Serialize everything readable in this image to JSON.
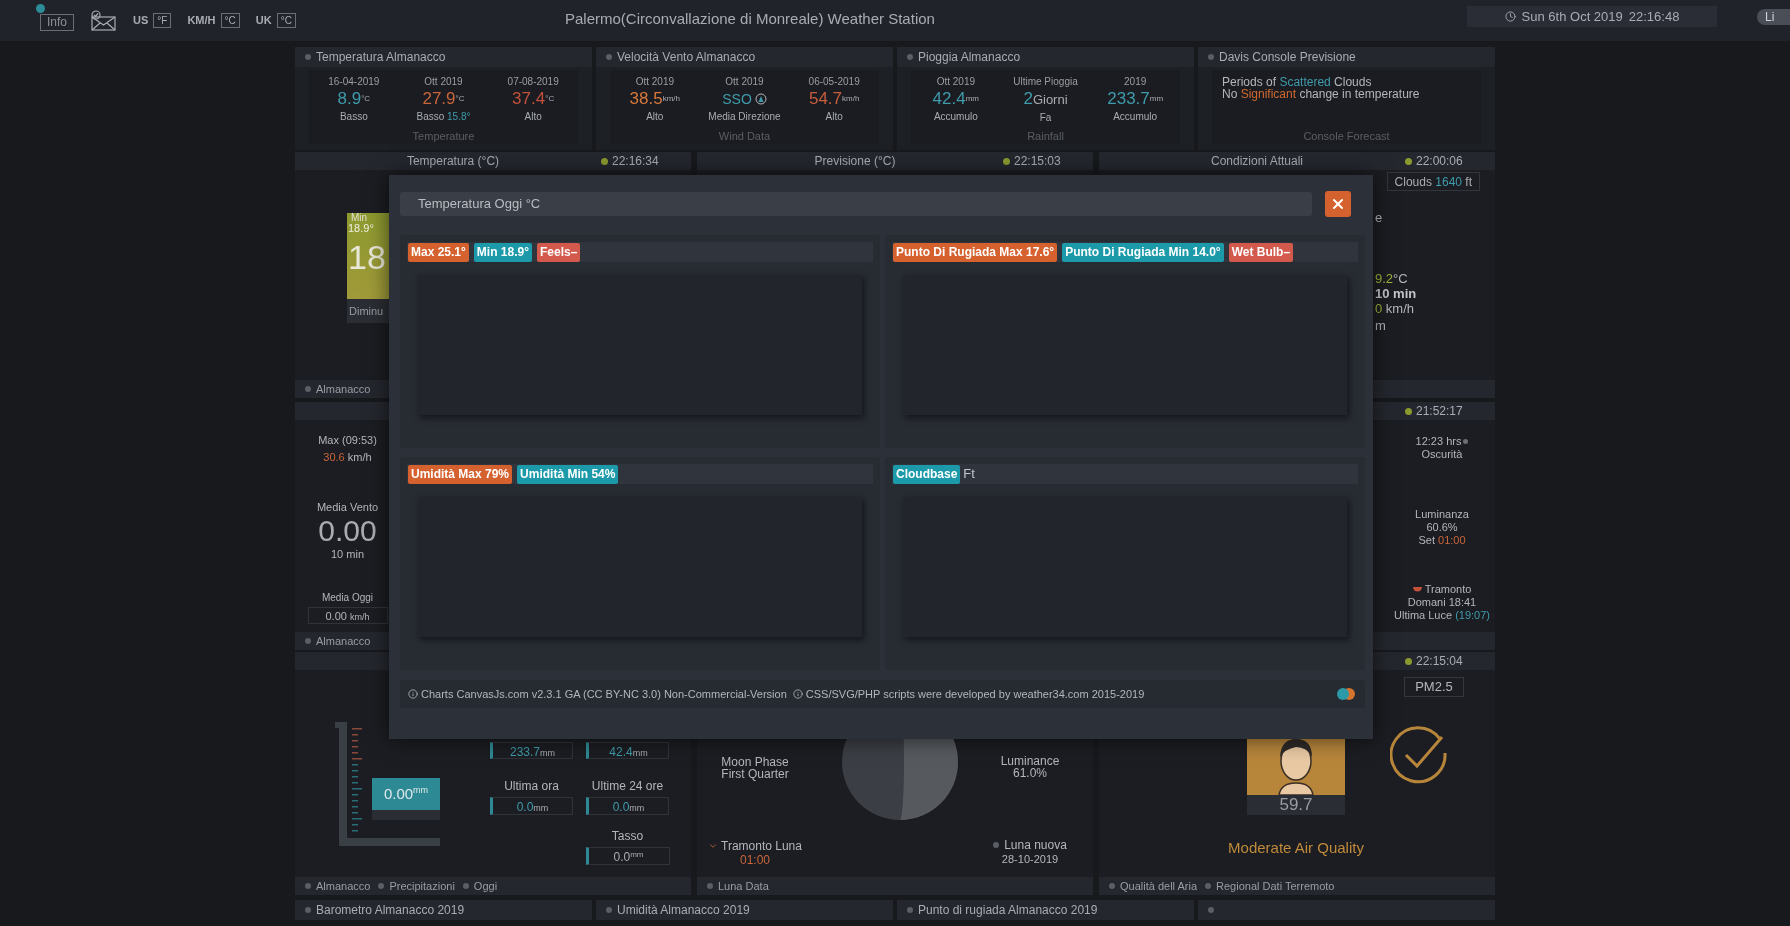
{
  "top_bar": {
    "info_button": "Info",
    "units": [
      {
        "region": "US",
        "unit": "°F"
      },
      {
        "region": "KM/H",
        "unit": "°C"
      },
      {
        "region": "UK",
        "unit": "°C"
      }
    ],
    "title": "Palermo(Circonvallazione di Monreale) Weather Station",
    "date": "Sun 6th Oct 2019",
    "time": "22:16:48",
    "theme_button": "Li"
  },
  "almanac_cards": [
    {
      "kind": "columns",
      "title": "Temperatura Almanacco",
      "caption": "Temperature",
      "columns": [
        {
          "kind": "measure",
          "date": "16-04-2019",
          "value": "8.9",
          "unit": "°C",
          "color": "#3f9bab",
          "label": "Basso"
        },
        {
          "kind": "measure",
          "date": "Ott 2019",
          "value": "27.9",
          "unit": "°C",
          "color": "#c9653a",
          "label": "Basso",
          "extra": "15.8°"
        },
        {
          "kind": "measure",
          "date": "07-08-2019",
          "value": "37.4",
          "unit": "°C",
          "color": "#c4503c",
          "label": "Alto"
        }
      ]
    },
    {
      "kind": "columns",
      "title": "Velocità Vento Almanacco",
      "caption": "Wind Data",
      "columns": [
        {
          "kind": "measure",
          "date": "Ott 2019",
          "value": "38.5",
          "unit": "km/h",
          "color": "#d8783a",
          "label": "Alto"
        },
        {
          "kind": "direction",
          "date": "Ott 2019",
          "value": "SSO",
          "color": "#3f9bab",
          "label": "Media Direzione"
        },
        {
          "kind": "measure",
          "date": "06-05-2019",
          "value": "54.7",
          "unit": "km/h",
          "color": "#c85e3c",
          "label": "Alto"
        }
      ]
    },
    {
      "kind": "columns",
      "title": "Pioggia Almanacco",
      "caption": "Rainfall",
      "columns": [
        {
          "kind": "measure",
          "date": "Ott 2019",
          "value": "42.4",
          "unit": "mm",
          "color": "#3f9bab",
          "label": "Accumulo"
        },
        {
          "kind": "count",
          "date": "Ultime Pioggia",
          "value": "2",
          "unit": "Giorni",
          "color": "#3f9bab",
          "label": "Fa"
        },
        {
          "kind": "measure",
          "date": "2019",
          "value": "233.7",
          "unit": "mm",
          "color": "#3f9bab",
          "label": "Accumulo"
        }
      ]
    },
    {
      "kind": "forecast",
      "title": "Davis Console Previsione",
      "caption": "Console Forecast",
      "lines": [
        [
          {
            "kind": "plain",
            "text": "Periods of "
          },
          {
            "kind": "cool",
            "text": "Scattered"
          },
          {
            "kind": "plain",
            "text": " Clouds"
          }
        ],
        [
          {
            "kind": "plain",
            "text": "No "
          },
          {
            "kind": "warm",
            "text": "Significant"
          },
          {
            "kind": "plain",
            "text": " change in temperature"
          }
        ]
      ]
    }
  ],
  "temperature_card": {
    "title": "Temperatura (°C)",
    "time": "22:16:34",
    "min_label": "Min",
    "min_value": "18.9°",
    "value": "18",
    "trend": "Diminu",
    "footer": [
      "Almanacco"
    ]
  },
  "forecast_card": {
    "title": "Previsione (°C)",
    "time": "22:15:03"
  },
  "conditions_card": {
    "title": "Condizioni Attuali",
    "time": "22:00:06",
    "clouds_label": "Clouds",
    "clouds_value": "1640",
    "clouds_unit": "ft",
    "lines": [
      [
        {
          "kind": "plain",
          "text": "e"
        }
      ],
      [
        {
          "kind": "lime",
          "text": "9.2"
        },
        {
          "kind": "plain",
          "text": "°C"
        }
      ],
      [
        {
          "kind": "bold",
          "text": "10 min"
        }
      ],
      [
        {
          "kind": "lime",
          "text": "0"
        },
        {
          "kind": "plain",
          "text": " km/h"
        }
      ],
      [
        {
          "kind": "plain",
          "text": "m"
        }
      ]
    ]
  },
  "wind_card": {
    "max_label": "Max (09:53)",
    "max_value": "30.6",
    "max_unit": "km/h",
    "avg_label": "Media Vento",
    "avg_value": "0.00",
    "avg_period": "10 min",
    "today_label": "Media Oggi",
    "today_value": "0.00",
    "today_unit": "km/h",
    "footer": [
      "Almanacco"
    ]
  },
  "sun_card": {
    "time": "21:52:17",
    "dark_hours": "12:23 hrs",
    "dark_label": "Oscurità",
    "luminance_label": "Luminanza",
    "luminance": "60.6%",
    "set_label": "Set",
    "set_time": "01:00",
    "sunset_label": "Tramonto",
    "sunset": "Domani 18:41",
    "last_light_label": "Ultima Luce",
    "last_light": "(19:07)"
  },
  "rain_card": {
    "gauge": "0.00",
    "gauge_unit": "mm",
    "month": "233.7",
    "month_unit": "mm",
    "year": "42.4",
    "year_unit": "mm",
    "hour_label": "Ultima ora",
    "hour": "0.0",
    "hour_unit": "mm",
    "day_label": "Ultime 24 ore",
    "day": "0.0",
    "day_unit": "mm",
    "rate_label": "Tasso",
    "rate": "0.0",
    "rate_unit": "mm",
    "footer": [
      "Almanacco",
      "Precipitazioni",
      "Oggi"
    ]
  },
  "moon_card": {
    "phase_label": "Moon Phase",
    "phase": "First Quarter",
    "luminance_label": "Luminance",
    "luminance": "61.0%",
    "moonset_label": "Tramonto Luna",
    "moonset": "01:00",
    "new_moon_label": "Luna nuova",
    "new_moon": "28-10-2019",
    "footer": [
      "Luna Data"
    ]
  },
  "air_card": {
    "time": "22:15:04",
    "sensor": "PM2.5",
    "value": "59.7",
    "quality": "Moderate Air Quality",
    "footer": [
      "Qualità dell Aria",
      "Regional Dati Terremoto"
    ]
  },
  "bottom_headers": [
    "Barometro Almanacco 2019",
    "Umidità Almanacco 2019",
    "Punto di rugiada Almanacco 2019"
  ],
  "modal": {
    "title": "Temperatura Oggi °C",
    "panels": [
      {
        "badges": [
          {
            "text": "Max 25.1°",
            "color": "#d5612f"
          },
          {
            "text": "Min 18.9°",
            "color": "#1c9aaa"
          },
          {
            "text": "Feels–",
            "color": "#d2594c"
          }
        ]
      },
      {
        "badges": [
          {
            "text": "Punto Di Rugiada Max 17.6°",
            "color": "#d5612f"
          },
          {
            "text": "Punto Di Rugiada Min 14.0°",
            "color": "#1c9aaa"
          },
          {
            "text": "Wet Bulb–",
            "color": "#d2594c"
          }
        ]
      },
      {
        "badges": [
          {
            "text": "Umidità Max 79%",
            "color": "#d5612f"
          },
          {
            "text": "Umidità Min 54%",
            "color": "#1c9aaa"
          }
        ]
      },
      {
        "badges": [
          {
            "text": "Cloudbase",
            "color": "#1c9aaa"
          }
        ],
        "suffix": "Ft"
      }
    ],
    "notes": [
      "Charts CanvasJs.com v2.3.1 GA (CC BY-NC 3.0) Non-Commercial-Version",
      "CSS/SVG/PHP scripts were developed by weather34.com 2015-2019"
    ]
  }
}
